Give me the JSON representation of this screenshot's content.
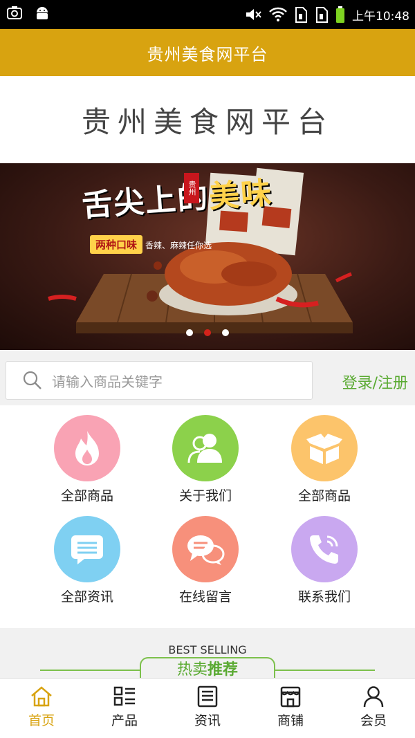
{
  "status_bar": {
    "time": "上午10:48",
    "icons": [
      "screenshot-icon",
      "android-icon",
      "mute-icon",
      "wifi-icon",
      "sim1-icon",
      "sim2-icon",
      "battery-icon"
    ]
  },
  "header": {
    "title": "贵州美食网平台"
  },
  "logo": {
    "text": "贵州美食网平台"
  },
  "banner": {
    "heading_main": "舌尖上的",
    "heading_accent": "美味",
    "tag": "贵州",
    "subtitle": "两种口味",
    "subtitle_extra": "香辣、麻辣任你选",
    "slide_count": 3,
    "active_slide": 2
  },
  "search": {
    "placeholder": "请输入商品关键字",
    "login_label": "登录/注册"
  },
  "grid": [
    {
      "label": "全部商品",
      "icon": "flame-icon",
      "color": "#f9a3b4"
    },
    {
      "label": "关于我们",
      "icon": "users-icon",
      "color": "#8cd14b"
    },
    {
      "label": "全部商品",
      "icon": "box-icon",
      "color": "#fcc46b"
    },
    {
      "label": "全部资讯",
      "icon": "message-icon",
      "color": "#7fd0f2"
    },
    {
      "label": "在线留言",
      "icon": "chat-icon",
      "color": "#f7907b"
    },
    {
      "label": "联系我们",
      "icon": "phone-icon",
      "color": "#c9a8f0"
    }
  ],
  "best_selling": {
    "en": "BEST SELLING",
    "zh_a": "热卖",
    "zh_b": "推荐"
  },
  "bottom_nav": [
    {
      "label": "首页",
      "icon": "home-icon",
      "active": true
    },
    {
      "label": "产品",
      "icon": "grid-list-icon",
      "active": false
    },
    {
      "label": "资讯",
      "icon": "news-icon",
      "active": false
    },
    {
      "label": "商铺",
      "icon": "shop-icon",
      "active": false
    },
    {
      "label": "会员",
      "icon": "user-icon",
      "active": false
    }
  ],
  "colors": {
    "accent": "#d8a310",
    "green": "#5aaa32",
    "active_dot": "#d2231b"
  }
}
